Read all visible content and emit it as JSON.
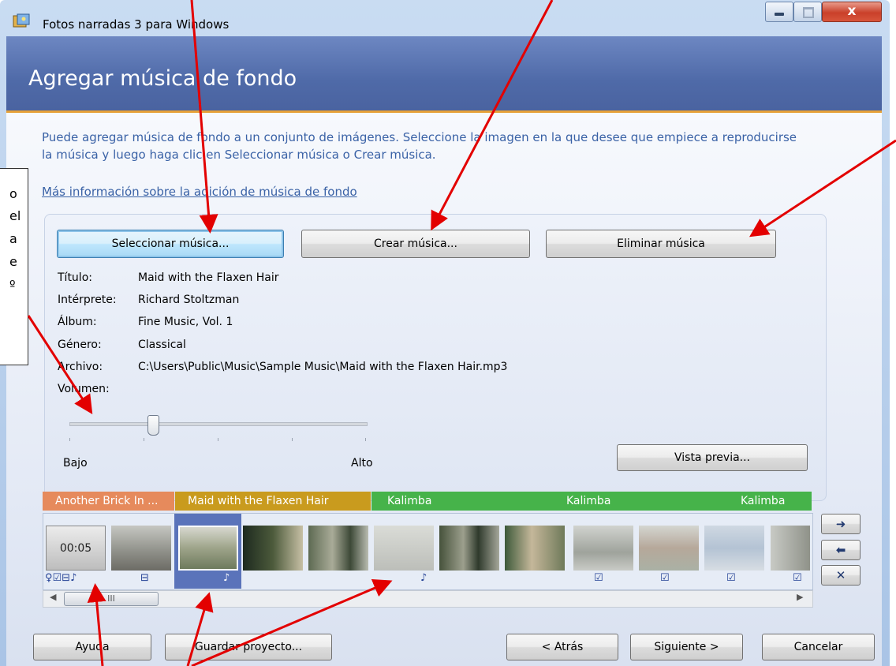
{
  "window": {
    "title": "Fotos narradas 3 para Windows",
    "close_glyph": "x"
  },
  "header": {
    "title": "Agregar música de fondo"
  },
  "intro": {
    "text": "Puede agregar música de fondo a un conjunto de imágenes. Seleccione la imagen en la que desee que empiece a reproducirse la música y luego haga clic en Seleccionar música o Crear música.",
    "link": "Más información sobre la adición de música de fondo"
  },
  "buttons": {
    "select_music": "Seleccionar música...",
    "create_music": "Crear música...",
    "remove_music": "Eliminar música",
    "preview": "Vista previa..."
  },
  "track_info": {
    "title_label": "Título:",
    "title_value": "Maid with the Flaxen Hair",
    "artist_label": "Intérprete:",
    "artist_value": "Richard Stoltzman",
    "album_label": "Álbum:",
    "album_value": "Fine Music, Vol. 1",
    "genre_label": "Género:",
    "genre_value": "Classical",
    "file_label": "Archivo:",
    "file_value": "C:\\Users\\Public\\Music\\Sample Music\\Maid with the Flaxen Hair.mp3",
    "volume_label": "Volumen:"
  },
  "volume": {
    "low_label": "Bajo",
    "high_label": "Alto",
    "level_fraction": 0.28
  },
  "timeline": {
    "music_tracks": [
      {
        "label": "Another Brick In ...",
        "color": "#e68a5c"
      },
      {
        "label": "Maid with the Flaxen Hair",
        "color": "#c99b1e"
      },
      {
        "label": "Kalimba",
        "color": "#46b34a"
      },
      {
        "label": "Kalimba",
        "color": "#46b34a"
      },
      {
        "label": "Kalimba",
        "color": "#46b34a"
      }
    ],
    "first_thumb_time": "00:05",
    "scroll_grip": "III",
    "side_buttons": [
      "arrow-right-icon",
      "arrow-left-icon",
      "remove-x-icon"
    ],
    "side_glyphs": [
      "➜",
      "⬅",
      "✕"
    ],
    "icon_glyphs": {
      "group": "♀☑⊟♪",
      "stack": "⊟",
      "note": "♪",
      "edit": "☑"
    }
  },
  "footer": {
    "help": "Ayuda",
    "save_project": "Guardar proyecto...",
    "back": "< Atrás",
    "next": "Siguiente >",
    "cancel": "Cancelar"
  },
  "annotation": {
    "lines": [
      "o",
      "el",
      "a",
      "e",
      "º"
    ]
  }
}
